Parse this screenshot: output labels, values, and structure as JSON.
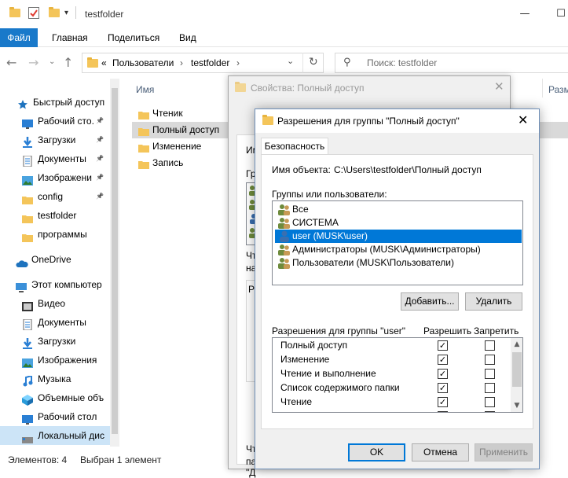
{
  "explorer": {
    "title": "testfolder",
    "ribbon": {
      "file": "Файл",
      "home": "Главная",
      "share": "Поделиться",
      "view": "Вид"
    },
    "address": {
      "chevron": "«",
      "crumbs": [
        "Пользователи",
        "testfolder"
      ],
      "sep": "›"
    },
    "search_placeholder": "Поиск: testfolder",
    "nav_items": [
      {
        "label": "Быстрый доступ",
        "icon": "star-icon"
      },
      {
        "label": "Рабочий сто.",
        "icon": "desktop-icon"
      },
      {
        "label": "Загрузки",
        "icon": "download-icon"
      },
      {
        "label": "Документы",
        "icon": "documents-icon"
      },
      {
        "label": "Изображени",
        "icon": "pictures-icon"
      },
      {
        "label": "config",
        "icon": "folder-icon"
      },
      {
        "label": "testfolder",
        "icon": "folder-icon"
      },
      {
        "label": "программы",
        "icon": "folder-icon"
      },
      {
        "label": "OneDrive",
        "icon": "cloud-icon"
      },
      {
        "label": "Этот компьютер",
        "icon": "computer-icon"
      },
      {
        "label": "Видео",
        "icon": "video-icon"
      },
      {
        "label": "Документы",
        "icon": "documents-icon"
      },
      {
        "label": "Загрузки",
        "icon": "download-icon"
      },
      {
        "label": "Изображения",
        "icon": "pictures-icon"
      },
      {
        "label": "Музыка",
        "icon": "music-icon"
      },
      {
        "label": "Объемные объ",
        "icon": "3d-objects-icon"
      },
      {
        "label": "Рабочий стол",
        "icon": "desktop-icon"
      },
      {
        "label": "Локальный дис",
        "icon": "drive-icon"
      }
    ],
    "column_name": "Имя",
    "column_size": "Разме",
    "files": [
      "Чтеник",
      "Полный доступ",
      "Изменение",
      "Запись"
    ],
    "status": {
      "count": "Элементов: 4",
      "selected": "Выбран 1 элемент"
    }
  },
  "props_dialog": {
    "title": "Свойства: Полный доступ",
    "fragments": [
      "Им",
      "Гру",
      "Чт",
      "на",
      "Ра",
      "Чт",
      "па",
      "\"Д"
    ]
  },
  "perm_dialog": {
    "title": "Разрешения для группы \"Полный доступ\"",
    "tab": "Безопасность",
    "object_label": "Имя объекта:",
    "object_value": "C:\\Users\\testfolder\\Полный доступ",
    "groups_label": "Группы или пользователи:",
    "users": [
      {
        "label": "Все",
        "selected": false
      },
      {
        "label": "СИСТЕМА",
        "selected": false
      },
      {
        "label": "user (MUSK\\user)",
        "selected": true
      },
      {
        "label": "Администраторы (MUSK\\Администраторы)",
        "selected": false
      },
      {
        "label": "Пользователи (MUSK\\Пользователи)",
        "selected": false
      }
    ],
    "add_button": "Добавить...",
    "remove_button": "Удалить",
    "perms_label": "Разрешения для группы \"user\"",
    "allow_header": "Разрешить",
    "deny_header": "Запретить",
    "permissions": [
      {
        "label": "Полный доступ",
        "allow": true,
        "deny": false
      },
      {
        "label": "Изменение",
        "allow": true,
        "deny": false
      },
      {
        "label": "Чтение и выполнение",
        "allow": true,
        "deny": false
      },
      {
        "label": "Список содержимого папки",
        "allow": true,
        "deny": false
      },
      {
        "label": "Чтение",
        "allow": true,
        "deny": false
      }
    ],
    "ok_button": "OK",
    "cancel_button": "Отмена",
    "apply_button": "Применить"
  }
}
